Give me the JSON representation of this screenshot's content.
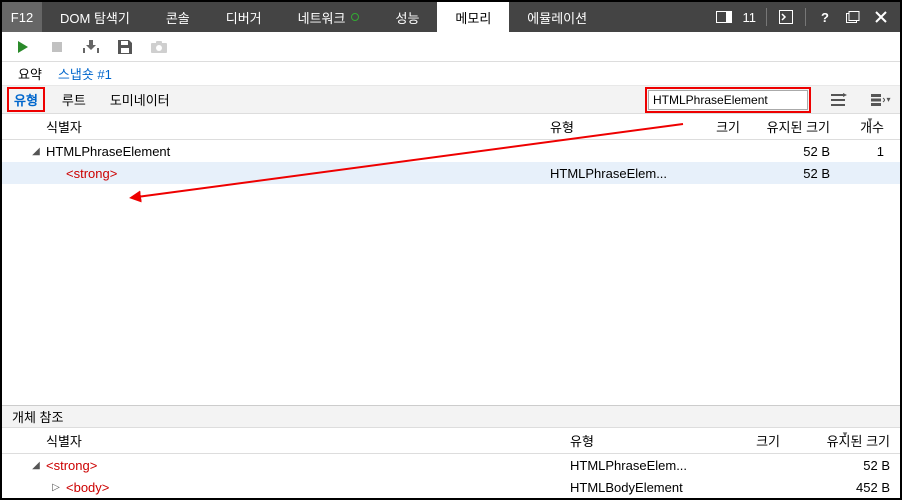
{
  "topbar": {
    "f12": "F12",
    "tabs": {
      "dom": "DOM 탐색기",
      "console": "콘솔",
      "debugger": "디버거",
      "network": "네트워크",
      "perf": "성능",
      "memory": "메모리",
      "emulation": "에뮬레이션"
    },
    "count": "11"
  },
  "snapshot": {
    "summary": "요약",
    "name": "스냅숏 #1"
  },
  "views": {
    "type": "유형",
    "root": "루트",
    "dominator": "도미네이터"
  },
  "search": {
    "value": "HTMLPhraseElement"
  },
  "cols": {
    "id": "식별자",
    "type": "유형",
    "size": "크기",
    "retained": "유지된 크기",
    "count": "개수"
  },
  "main_rows": {
    "r0": {
      "id": "HTMLPhraseElement",
      "type": "",
      "size": "",
      "retained": "52 B",
      "count": "1"
    },
    "r1": {
      "id": "<strong>",
      "type": "HTMLPhraseElem...",
      "size": "",
      "retained": "52 B",
      "count": ""
    }
  },
  "bottom": {
    "title": "개체 참조",
    "rows": {
      "r0": {
        "id": "<strong>",
        "type": "HTMLPhraseElem...",
        "size": "",
        "retained": "52 B"
      },
      "r1": {
        "id": "<body>",
        "type": "HTMLBodyElement",
        "size": "",
        "retained": "452 B"
      }
    }
  }
}
